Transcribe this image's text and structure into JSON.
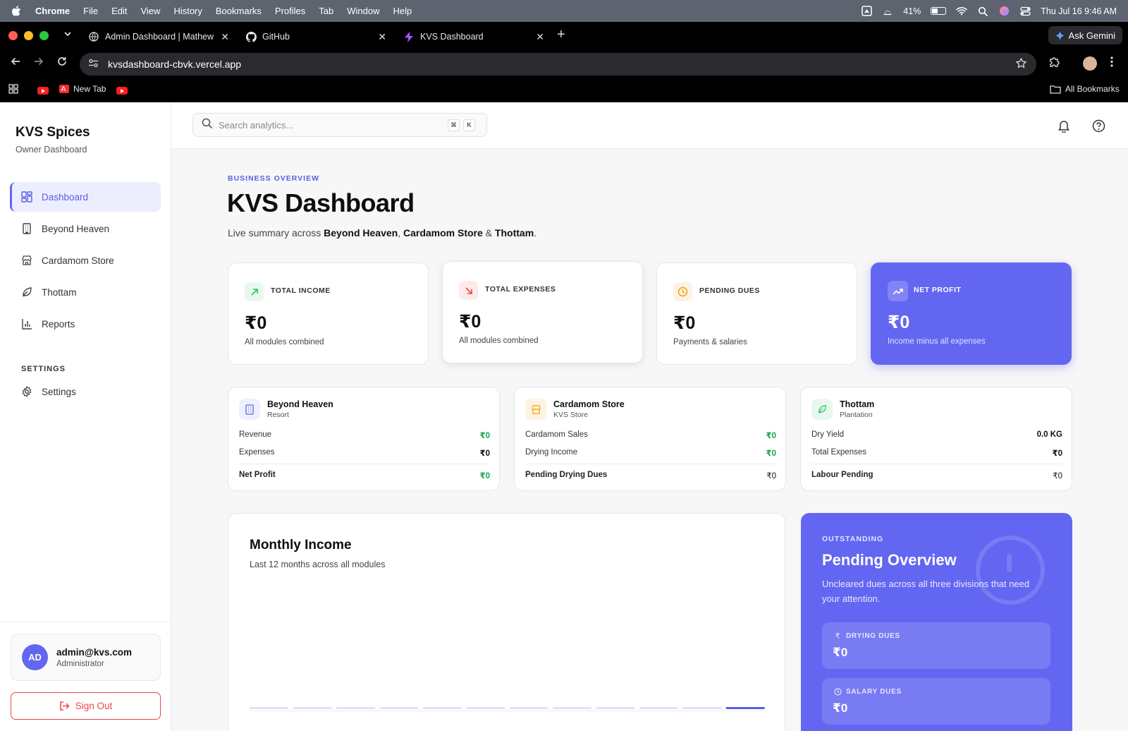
{
  "menubar": {
    "app": "Chrome",
    "items": [
      "File",
      "Edit",
      "View",
      "History",
      "Bookmarks",
      "Profiles",
      "Tab",
      "Window",
      "Help"
    ],
    "battery": "41%",
    "datetime": "Thu Jul 16  9:46 AM"
  },
  "browser": {
    "tabs": [
      {
        "title": "Admin Dashboard | Mathew S",
        "icon": "globe-icon"
      },
      {
        "title": "GitHub",
        "icon": "github-icon"
      },
      {
        "title": "KVS Dashboard",
        "icon": "bolt-icon"
      }
    ],
    "ask_gemini": "Ask Gemini",
    "url": "kvsdashboard-cbvk.vercel.app",
    "bookmarks": {
      "new_tab": "New Tab",
      "all_bookmarks": "All Bookmarks"
    }
  },
  "sidebar": {
    "brand": "KVS Spices",
    "brand_sub": "Owner Dashboard",
    "items": [
      {
        "label": "Dashboard",
        "icon": "grid-icon",
        "active": true
      },
      {
        "label": "Beyond Heaven",
        "icon": "building-icon"
      },
      {
        "label": "Cardamom Store",
        "icon": "store-icon"
      },
      {
        "label": "Thottam",
        "icon": "leaf-icon"
      },
      {
        "label": "Reports",
        "icon": "bar-chart-icon"
      }
    ],
    "settings_heading": "SETTINGS",
    "settings_label": "Settings",
    "user": {
      "initials": "AD",
      "email": "admin@kvs.com",
      "role": "Administrator"
    },
    "sign_out": "Sign Out"
  },
  "topbar": {
    "search_placeholder": "Search analytics...",
    "kbd": [
      "⌘",
      "K"
    ]
  },
  "header": {
    "eyebrow": "BUSINESS OVERVIEW",
    "title": "KVS Dashboard",
    "subtitle_prefix": "Live summary across ",
    "subtitle_parts": [
      "Beyond Heaven",
      "Cardamom Store",
      "Thottam"
    ],
    "subtitle_sep1": ", ",
    "subtitle_sep2": " & ",
    "subtitle_end": "."
  },
  "stats": [
    {
      "label": "TOTAL INCOME",
      "value": "₹0",
      "note": "All modules combined",
      "color": "#22c55e"
    },
    {
      "label": "TOTAL EXPENSES",
      "value": "₹0",
      "note": "All modules combined",
      "color": "#ef4444"
    },
    {
      "label": "PENDING DUES",
      "value": "₹0",
      "note": "Payments & salaries",
      "color": "#f59e0b"
    },
    {
      "label": "NET PROFIT",
      "value": "₹0",
      "note": "Income minus all expenses",
      "color": "#ffffff"
    }
  ],
  "modules": [
    {
      "name": "Beyond Heaven",
      "sub": "Resort",
      "rows": [
        {
          "label": "Revenue",
          "value": "₹0"
        },
        {
          "label": "Expenses",
          "value": "₹0"
        }
      ],
      "total": {
        "label": "Net Profit",
        "value": "₹0"
      }
    },
    {
      "name": "Cardamom Store",
      "sub": "KVS Store",
      "rows": [
        {
          "label": "Cardamom Sales",
          "value": "₹0"
        },
        {
          "label": "Drying Income",
          "value": "₹0"
        }
      ],
      "total": {
        "label": "Pending Drying Dues",
        "value": "₹0"
      }
    },
    {
      "name": "Thottam",
      "sub": "Plantation",
      "rows": [
        {
          "label": "Dry Yield",
          "value": "0.0 KG"
        },
        {
          "label": "Total Expenses",
          "value": "₹0"
        }
      ],
      "total": {
        "label": "Labour Pending",
        "value": "₹0"
      }
    }
  ],
  "monthly_income": {
    "title": "Monthly Income",
    "subtitle": "Last 12 months across all modules"
  },
  "chart_data": {
    "type": "bar",
    "title": "Monthly Income",
    "subtitle": "Last 12 months across all modules",
    "categories": [],
    "values": [
      0,
      0,
      0,
      0,
      0,
      0,
      0,
      0,
      0,
      0,
      0,
      0
    ],
    "highlight_index": 11,
    "xlabel": "",
    "ylabel": "",
    "grid": false,
    "colors": {
      "bar": "#e0e3f8",
      "highlight": "#5b5ce6"
    }
  },
  "pending": {
    "eyebrow": "OUTSTANDING",
    "title": "Pending Overview",
    "desc": "Uncleared dues across all three divisions that need your attention.",
    "items": [
      {
        "label": "DRYING DUES",
        "value": "₹0",
        "icon": "rupee-icon"
      },
      {
        "label": "SALARY DUES",
        "value": "₹0",
        "icon": "clock-icon"
      }
    ]
  },
  "colors": {
    "accent": "#6366f1",
    "danger": "#ef4444",
    "success": "#16a34a"
  }
}
